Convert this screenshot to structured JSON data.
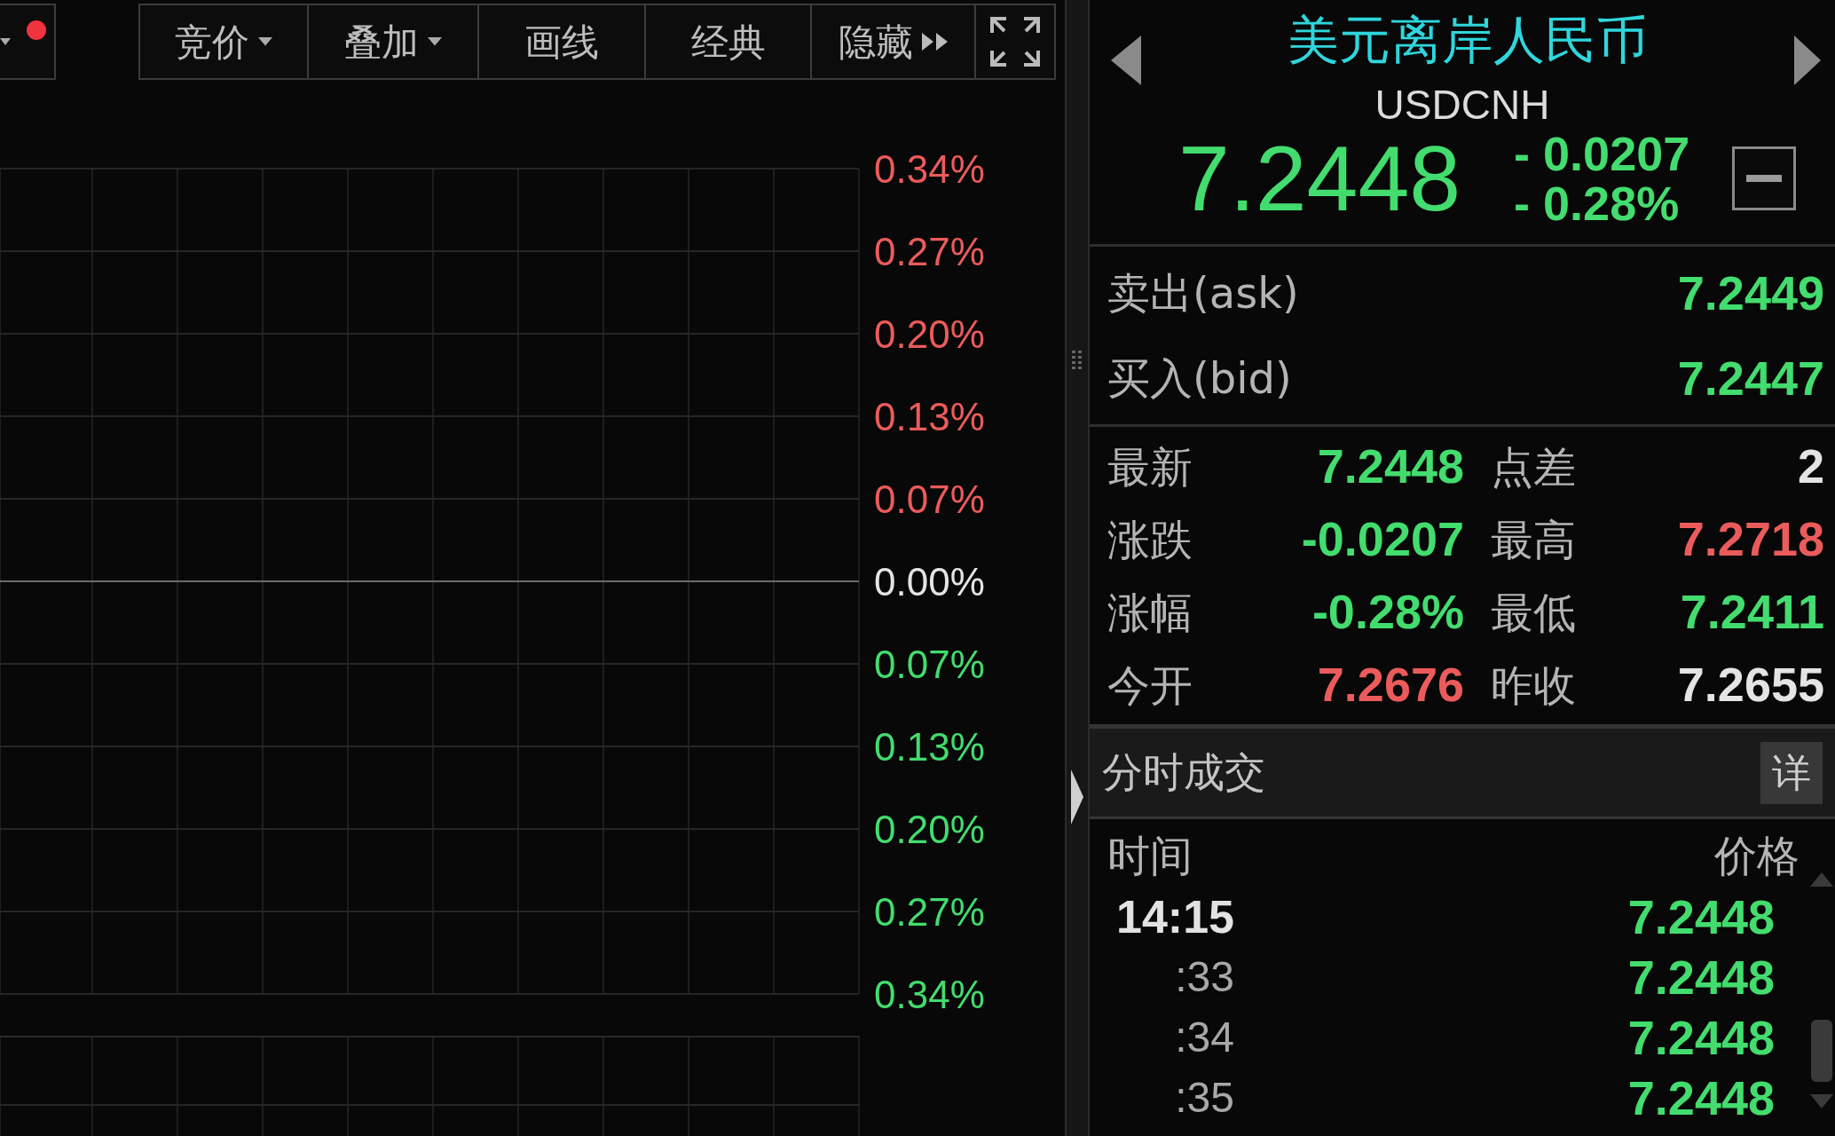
{
  "toolbar": {
    "partial_button": {
      "indicator": true
    },
    "buttons": [
      {
        "label": "竞价",
        "kind": "dropdown"
      },
      {
        "label": "叠加",
        "kind": "dropdown"
      },
      {
        "label": "画线",
        "kind": "plain"
      },
      {
        "label": "经典",
        "kind": "plain"
      },
      {
        "label": "隐藏",
        "kind": "collapse"
      }
    ]
  },
  "chart": {
    "axis_labels": [
      {
        "text": "0.34%",
        "color": "#ec5b5b"
      },
      {
        "text": "0.27%",
        "color": "#ec5b5b"
      },
      {
        "text": "0.20%",
        "color": "#ec5b5b"
      },
      {
        "text": "0.13%",
        "color": "#ec5b5b"
      },
      {
        "text": "0.07%",
        "color": "#ec5b5b"
      },
      {
        "text": "0.00%",
        "color": "#e4e4e4"
      },
      {
        "text": "0.07%",
        "color": "#43dc6e"
      },
      {
        "text": "0.13%",
        "color": "#43dc6e"
      },
      {
        "text": "0.20%",
        "color": "#43dc6e"
      },
      {
        "text": "0.27%",
        "color": "#43dc6e"
      },
      {
        "text": "0.34%",
        "color": "#43dc6e"
      }
    ]
  },
  "quote": {
    "name": "美元离岸人民币",
    "code": "USDCNH",
    "price": "7.2448",
    "change": "- 0.0207",
    "change_pct": "- 0.28%",
    "color": "#43dc6e"
  },
  "ask_bid": [
    {
      "label": "卖出(ask)",
      "value": "7.2449",
      "color": "#43dc6e"
    },
    {
      "label": "买入(bid)",
      "value": "7.2447",
      "color": "#43dc6e"
    }
  ],
  "stats": [
    {
      "label": "最新",
      "value": "7.2448",
      "color": "#43dc6e"
    },
    {
      "label": "点差",
      "value": "2",
      "color": "#e4e4e4"
    },
    {
      "label": "涨跌",
      "value": "-0.0207",
      "color": "#43dc6e"
    },
    {
      "label": "最高",
      "value": "7.2718",
      "color": "#ec5b5b"
    },
    {
      "label": "涨幅",
      "value": "-0.28%",
      "color": "#43dc6e"
    },
    {
      "label": "最低",
      "value": "7.2411",
      "color": "#43dc6e"
    },
    {
      "label": "今开",
      "value": "7.2676",
      "color": "#ec5b5b"
    },
    {
      "label": "昨收",
      "value": "7.2655",
      "color": "#e4e4e4"
    }
  ],
  "trades": {
    "title": "分时成交",
    "detail_button": "详",
    "columns": [
      "时间",
      "价格"
    ],
    "rows": [
      {
        "time": "14:15",
        "kind": "minute",
        "price": "7.2448",
        "color": "#43dc6e"
      },
      {
        "time": ":33",
        "kind": "second",
        "price": "7.2448",
        "color": "#43dc6e"
      },
      {
        "time": ":34",
        "kind": "second",
        "price": "7.2448",
        "color": "#43dc6e"
      },
      {
        "time": ":35",
        "kind": "second",
        "price": "7.2448",
        "color": "#43dc6e"
      }
    ]
  }
}
